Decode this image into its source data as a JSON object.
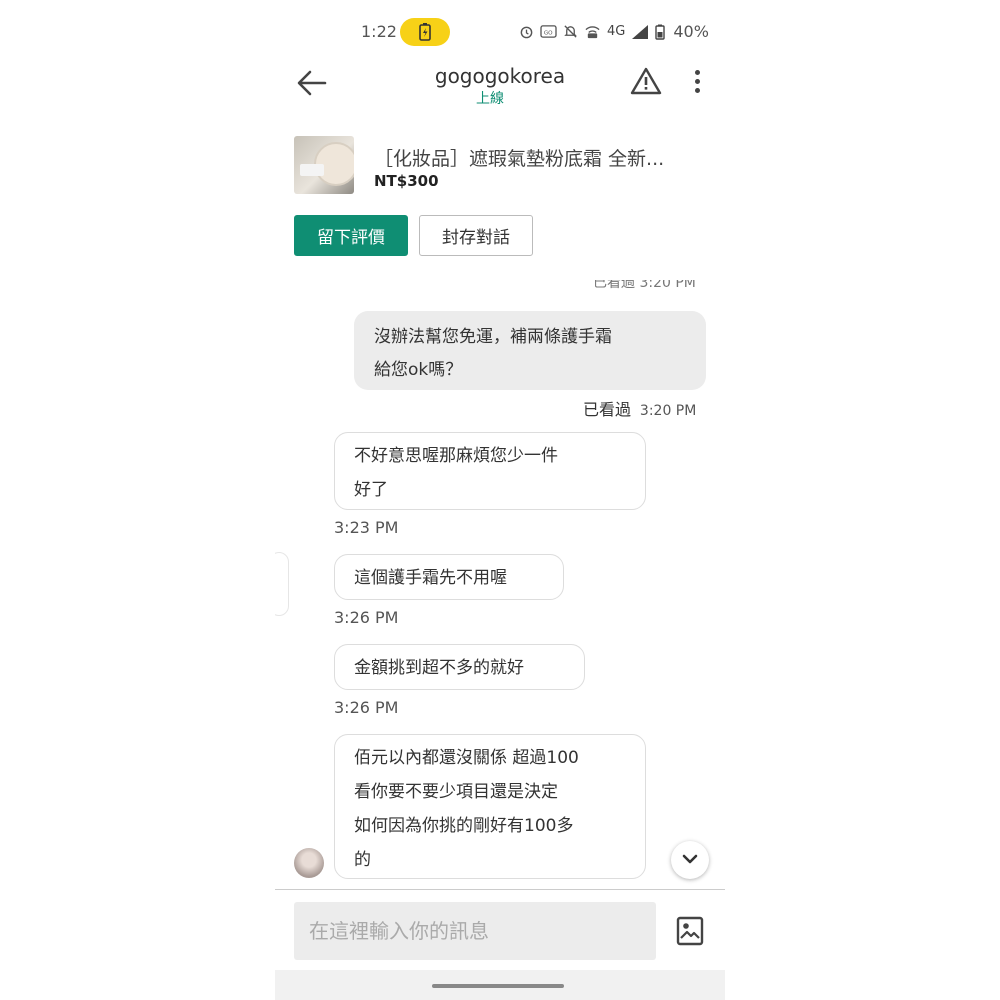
{
  "status_bar": {
    "time": "1:22",
    "net": "4G",
    "battery_pct": "40%"
  },
  "header": {
    "title": "gogogokorea",
    "subtitle": "上線"
  },
  "product": {
    "name": "［化妝品］遮瑕氣墊粉底霜 全新...",
    "price": "NT$300"
  },
  "actions": {
    "review_label": "留下評價",
    "archive_label": "封存對話"
  },
  "chat": {
    "top_meta": "已看過 3:20 PM",
    "outgoing": {
      "line1": "沒辦法幫您免運，補兩條護手霜",
      "line2": "給您ok嗎？",
      "read_label": "已看過",
      "time": "3:20 PM"
    },
    "incoming": [
      {
        "lines": [
          "不好意思喔那麻煩您少一件",
          "好了"
        ],
        "time": "3:23 PM"
      },
      {
        "lines": [
          "這個護手霜先不用喔"
        ],
        "time": "3:26 PM"
      },
      {
        "lines": [
          "金額挑到超不多的就好"
        ],
        "time": "3:26 PM"
      },
      {
        "lines": [
          "佰元以內都還沒關係 超過100",
          "看你要不要少項目還是決定",
          "如何因為你挑的剛好有100多",
          "的"
        ]
      }
    ]
  },
  "composer": {
    "placeholder": "在這裡輸入你的訊息"
  },
  "colors": {
    "accent": "#0f8e73",
    "bubble_out": "#ececec"
  }
}
